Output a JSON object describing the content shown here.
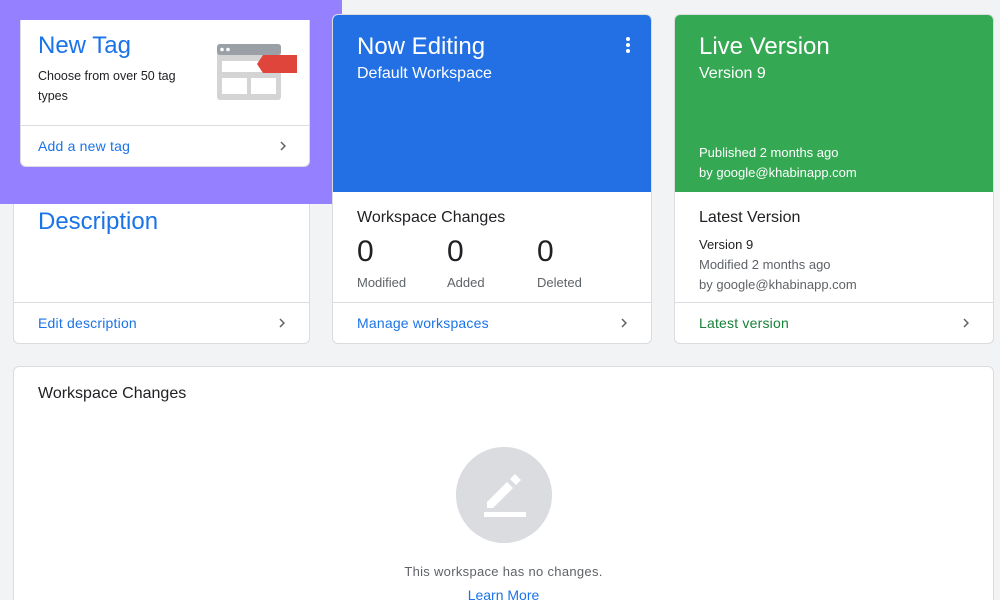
{
  "new_tag": {
    "title": "New Tag",
    "description": "Choose from over 50 tag types",
    "link": "Add a new tag",
    "highlight_color": "#9580ff"
  },
  "description_card": {
    "title": "Description",
    "link": "Edit description"
  },
  "now_editing": {
    "title": "Now Editing",
    "workspace": "Default Workspace",
    "menu_icon": "more-vert-icon",
    "section_title": "Workspace Changes",
    "stats": [
      {
        "value": "0",
        "label": "Modified"
      },
      {
        "value": "0",
        "label": "Added"
      },
      {
        "value": "0",
        "label": "Deleted"
      }
    ],
    "link": "Manage workspaces",
    "banner_color": "#2270e3"
  },
  "live_version": {
    "title": "Live Version",
    "version": "Version 9",
    "published": "Published 2 months ago",
    "published_by": "by google@khabinapp.com",
    "section_title": "Latest Version",
    "latest_version": "Version 9",
    "modified": "Modified 2 months ago",
    "modified_by": "by google@khabinapp.com",
    "link": "Latest version",
    "banner_color": "#34a853"
  },
  "workspace_changes": {
    "title": "Workspace Changes",
    "empty_icon": "pencil-icon",
    "empty_text": "This workspace has no changes.",
    "learn_more": "Learn More"
  }
}
